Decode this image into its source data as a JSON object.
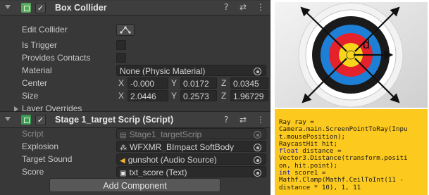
{
  "box_collider": {
    "title": "Box Collider",
    "header_buttons": [
      "?",
      "⇄",
      "⋮"
    ],
    "edit_collider_label": "Edit Collider",
    "is_trigger_label": "Is Trigger",
    "provides_contacts_label": "Provides Contacts",
    "material_label": "Material",
    "material_value": "None (Physic Material)",
    "center_label": "Center",
    "center": {
      "x": "-0.000",
      "y": "0.0172",
      "z": "0.0345"
    },
    "size_label": "Size",
    "size": {
      "x": "2.0446",
      "y": "0.2573",
      "z": "1.96729"
    },
    "layer_overrides_label": "Layer Overrides",
    "axis_labels": {
      "x": "X",
      "y": "Y",
      "z": "Z"
    }
  },
  "script_component": {
    "title": "Stage 1_target Scrip (Script)",
    "header_buttons": [
      "?",
      "⇄",
      "⋮"
    ],
    "rows": [
      {
        "label": "Script",
        "value": "Stage1_targetScrip",
        "icon": "script-asset-icon"
      },
      {
        "label": "Explosion",
        "value": "WFXMR_BImpact SoftBody",
        "icon": "prefab-icon"
      },
      {
        "label": "Target Sound",
        "value": "gunshot (Audio Source)",
        "icon": "audio-icon"
      },
      {
        "label": "Score",
        "value": "txt_score (Text)",
        "icon": "text-icon"
      }
    ]
  },
  "add_component_label": "Add Component",
  "target_image": {
    "annotation_label": "d"
  },
  "code_lines": [
    "Ray ray =",
    "Camera.main.ScreenPointToRay(Inpu",
    "t.mousePosition);",
    "RaycastHit hit;",
    "float distance =",
    "Vector3.Distance(transform.positi",
    "on, hit.point);",
    "int score1 =",
    "Mathf.Clamp(Mathf.CeilToInt(11 -",
    "distance * 10), 1, 11"
  ],
  "colors": {
    "panel_bg": "#383838",
    "code_bg": "#fcc91e",
    "keyword": "#1a1acc",
    "ring_red": "#e5222b",
    "ring_blue": "#1e7fd6",
    "ring_black": "#1a1a1a",
    "ring_yellow": "#f6d51a"
  }
}
